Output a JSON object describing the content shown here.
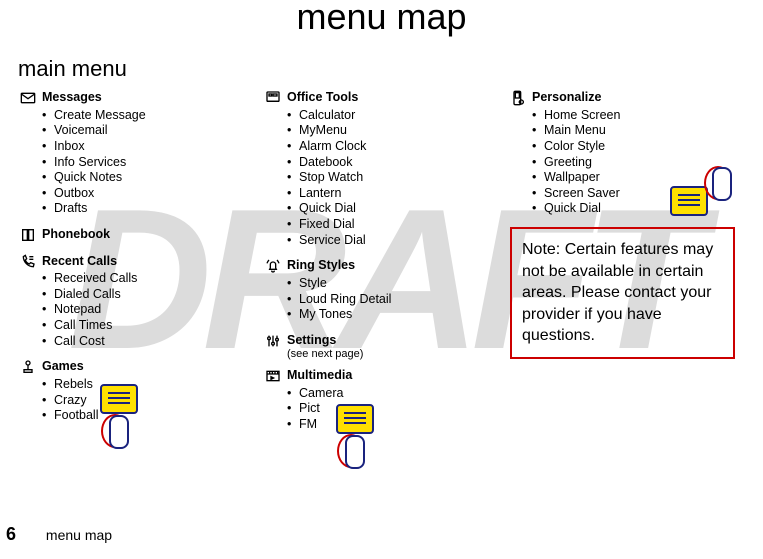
{
  "watermark": "DRAFT",
  "title": "menu map",
  "main_heading": "main menu",
  "footer": {
    "page_number": "6",
    "label": "menu map"
  },
  "note": "Note: Certain features may not be available in certain areas. Please contact your provider if you have questions.",
  "columns": [
    [
      {
        "icon": "envelope",
        "heading": "Messages",
        "items": [
          "Create Message",
          "Voicemail",
          "Inbox",
          "Info Services",
          "Quick Notes",
          "Outbox",
          "Drafts"
        ]
      },
      {
        "icon": "book",
        "heading": "Phonebook",
        "items": []
      },
      {
        "icon": "phone-list",
        "heading": "Recent Calls",
        "items": [
          "Received Calls",
          "Dialed Calls",
          "Notepad",
          "Call Times",
          "Call Cost"
        ]
      },
      {
        "icon": "joystick",
        "heading": "Games",
        "items": [
          "Rebels",
          "Crazy",
          "Football"
        ]
      }
    ],
    [
      {
        "icon": "tools",
        "heading": "Office Tools",
        "items": [
          "Calculator",
          "MyMenu",
          "Alarm Clock",
          "Datebook",
          "Stop Watch",
          "Lantern",
          "Quick Dial",
          "Fixed Dial",
          "Service Dial"
        ]
      },
      {
        "icon": "bell",
        "heading": "Ring Styles",
        "items": [
          "Style",
          "Loud Ring Detail",
          "My Tones"
        ]
      },
      {
        "icon": "sliders",
        "heading": "Settings",
        "sub": "(see next page)",
        "items": []
      },
      {
        "icon": "film",
        "heading": "Multimedia",
        "items": [
          "Camera",
          "Pict",
          "FM"
        ]
      }
    ],
    [
      {
        "icon": "phone-gear",
        "heading": "Personalize",
        "items": [
          "Home Screen",
          "Main Menu",
          "Color Style",
          "Greeting",
          "Wallpaper",
          "Screen Saver",
          "Quick Dial"
        ]
      }
    ]
  ]
}
